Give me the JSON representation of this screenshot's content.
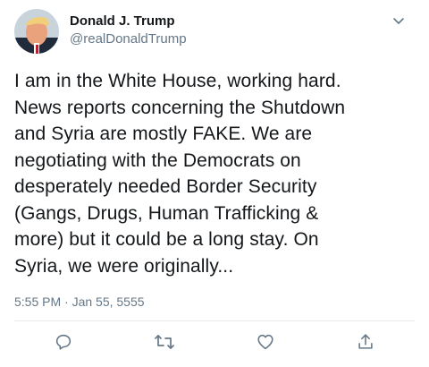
{
  "user": {
    "display_name": "Donald J. Trump",
    "handle": "@realDonaldTrump"
  },
  "tweet": {
    "text": "I am in the White House, working hard.\nNews reports concerning the Shutdown\nand Syria are mostly FAKE. We are\nnegotiating with the Democrats on\ndesperately needed Border Security\n(Gangs, Drugs, Human Trafficking &\nmore) but it could be a long stay. On\nSyria, we were originally...",
    "timestamp": "5:55 PM · Jan 55, 5555"
  },
  "actions": [
    {
      "name": "reply",
      "icon": "reply-icon"
    },
    {
      "name": "retweet",
      "icon": "retweet-icon"
    },
    {
      "name": "like",
      "icon": "heart-icon"
    },
    {
      "name": "share",
      "icon": "share-icon"
    }
  ],
  "colors": {
    "text": "#14171a",
    "secondary": "#657786",
    "divider": "#e6ecf0",
    "icon": "#657786"
  }
}
